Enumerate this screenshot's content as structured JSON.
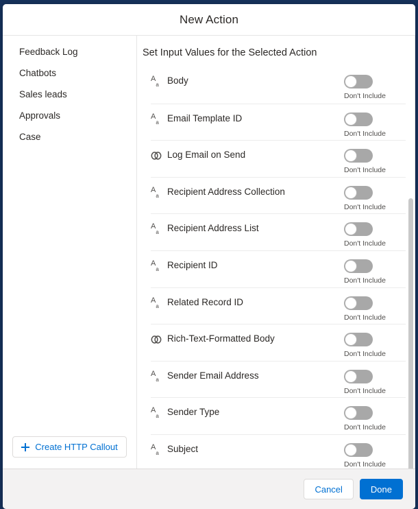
{
  "modal": {
    "title": "New Action"
  },
  "sidebar": {
    "items": [
      {
        "label": "Feedback Log"
      },
      {
        "label": "Chatbots"
      },
      {
        "label": "Sales leads"
      },
      {
        "label": "Approvals"
      },
      {
        "label": "Case"
      }
    ],
    "create_callout_label": "Create HTTP Callout",
    "plus_icon": "plus-icon"
  },
  "content": {
    "heading": "Set Input Values for the Selected Action",
    "toggle_off_label": "Don't Include",
    "rows": [
      {
        "label": "Body",
        "type_icon": "text-type-icon",
        "type_glyph": "Aa",
        "toggle_state": "off",
        "toggle_label": "Don't Include"
      },
      {
        "label": "Email Template ID",
        "type_icon": "text-type-icon",
        "type_glyph": "Aa",
        "toggle_state": "off",
        "toggle_label": "Don't Include"
      },
      {
        "label": "Log Email on Send",
        "type_icon": "boolean-type-icon",
        "type_glyph": "∞",
        "toggle_state": "off",
        "toggle_label": "Don't Include"
      },
      {
        "label": "Recipient Address Collection",
        "type_icon": "text-type-icon",
        "type_glyph": "Aa",
        "toggle_state": "off",
        "toggle_label": "Don't Include"
      },
      {
        "label": "Recipient Address List",
        "type_icon": "text-type-icon",
        "type_glyph": "Aa",
        "toggle_state": "off",
        "toggle_label": "Don't Include"
      },
      {
        "label": "Recipient ID",
        "type_icon": "text-type-icon",
        "type_glyph": "Aa",
        "toggle_state": "off",
        "toggle_label": "Don't Include"
      },
      {
        "label": "Related Record ID",
        "type_icon": "text-type-icon",
        "type_glyph": "Aa",
        "toggle_state": "off",
        "toggle_label": "Don't Include"
      },
      {
        "label": "Rich-Text-Formatted Body",
        "type_icon": "boolean-type-icon",
        "type_glyph": "∞",
        "toggle_state": "off",
        "toggle_label": "Don't Include"
      },
      {
        "label": "Sender Email Address",
        "type_icon": "text-type-icon",
        "type_glyph": "Aa",
        "toggle_state": "off",
        "toggle_label": "Don't Include"
      },
      {
        "label": "Sender Type",
        "type_icon": "text-type-icon",
        "type_glyph": "Aa",
        "toggle_state": "off",
        "toggle_label": "Don't Include"
      },
      {
        "label": "Subject",
        "type_icon": "text-type-icon",
        "type_glyph": "Aa",
        "toggle_state": "off",
        "toggle_label": "Don't Include"
      }
    ]
  },
  "footer": {
    "cancel_label": "Cancel",
    "done_label": "Done"
  },
  "colors": {
    "brand_blue": "#0070d2",
    "chrome_navy": "#16325c",
    "footer_gray": "#f3f2f2",
    "toggle_off_gray": "#a8a8a8",
    "text_primary": "#2b2826",
    "divider": "#ececec"
  }
}
